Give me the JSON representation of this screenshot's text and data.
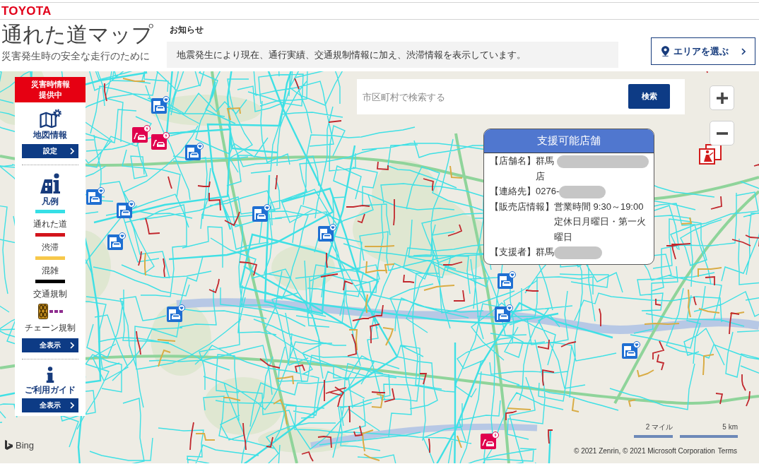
{
  "brand": {
    "logo": "TOYOTA"
  },
  "header": {
    "title": "通れた道マップ",
    "subtitle": "災害発生時の安全な走行のために",
    "notice": {
      "heading": "お知らせ",
      "text": "地震発生により現在、通行実績、交通規制情報に加え、渋滞情報を表示しています。"
    },
    "area_button": "エリアを選ぶ"
  },
  "sidebar": {
    "banner": [
      "災害時情報",
      "提供中"
    ],
    "sections": [
      {
        "kind": "map_info",
        "title": "地図情報",
        "button": "設定"
      },
      {
        "kind": "legend",
        "title": "凡例",
        "items": [
          {
            "kind": "line",
            "label": "通れた道",
            "color": "#36dfe6"
          },
          {
            "kind": "line",
            "label": "渋滞",
            "color": "#d3141c"
          },
          {
            "kind": "line",
            "label": "混雑",
            "color": "#f7c84a"
          },
          {
            "kind": "line",
            "label": "交通規制",
            "color": "#000000"
          },
          {
            "kind": "chain",
            "label": "チェーン規制",
            "color": "#8e2d8f"
          }
        ],
        "button": "全表示"
      },
      {
        "kind": "guide",
        "title": "ご利用ガイド",
        "button": "全表示"
      }
    ]
  },
  "search": {
    "placeholder": "市区町村で検索する",
    "button": "検索"
  },
  "popup": {
    "title": "支援可能店舗",
    "rows": [
      {
        "label": "【店舗名】",
        "value": "群馬",
        "redacted": true,
        "extra": "店"
      },
      {
        "label": "【連絡先】",
        "value": "0276-",
        "redacted": true
      },
      {
        "label": "【販売店情報】",
        "value": "営業時間 9:30～19:00",
        "redacted": false,
        "extra": "定休日月曜日・第一火曜日"
      },
      {
        "label": "【支援者】",
        "value": "群馬",
        "redacted": true
      }
    ]
  },
  "map_footer": {
    "logo": "Bing",
    "scale": [
      "2 マイル",
      "5 km"
    ],
    "attribution": "© 2021 Zenrin, © 2021 Microsoft Corporation",
    "terms": "Terms"
  }
}
